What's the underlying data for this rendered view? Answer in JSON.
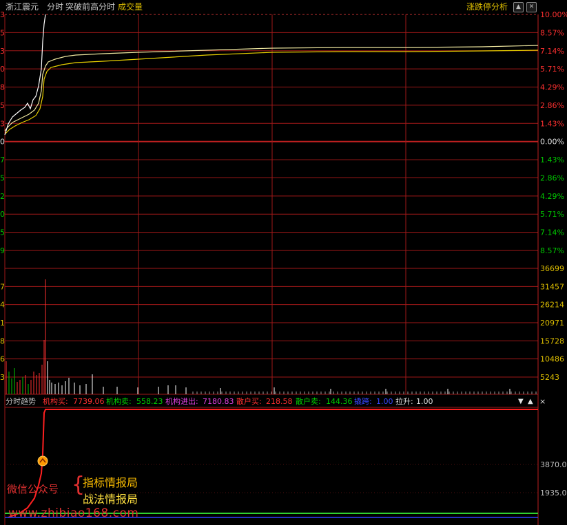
{
  "header": {
    "stock_name": "浙江震元",
    "mode_fenshi": "分时",
    "indicator_name": "突破前高分时",
    "volume_label": "成交量",
    "right_title": "涨跌停分析",
    "up_arrow": "▲",
    "close_icon": "✕"
  },
  "price_axis": {
    "right_labels": [
      "10.00%",
      "8.57%",
      "7.14%",
      "5.71%",
      "4.29%",
      "2.86%",
      "1.43%",
      "0.00%",
      "1.43%",
      "2.86%",
      "4.29%",
      "5.71%",
      "7.14%",
      "8.57%"
    ],
    "left_labels": [
      "3",
      "5",
      "3",
      "0",
      "8",
      "5",
      "3",
      "0",
      "7",
      "5",
      "2",
      "0",
      "5",
      "9"
    ]
  },
  "volume_axis": {
    "right_labels": [
      "36699",
      "31457",
      "26214",
      "20971",
      "15728",
      "10486",
      "5243"
    ],
    "left_labels": [
      "7",
      "4",
      "1",
      "8",
      "6",
      "3"
    ]
  },
  "indicator": {
    "name": "分时趋势",
    "jg_buy_label": "机构买:",
    "jg_buy_value": "7739.06",
    "jg_sell_label": "机构卖:",
    "jg_sell_value": "558.23",
    "jg_net_label": "机构进出:",
    "jg_net_value": "7180.83",
    "sh_buy_label": "散户买:",
    "sh_buy_value": "218.58",
    "sh_sell_label": "散户卖:",
    "sh_sell_value": "144.36",
    "ht_label": "撬跨:",
    "ht_value": "1.00",
    "ls_label": "拉升:",
    "ls_value": "1.00",
    "dropdown_icon": "▼",
    "up_icon": "▲",
    "close_icon": "×",
    "right_labels": [
      "3870.0",
      "1935.0"
    ]
  },
  "watermark": {
    "line1": "微信公众号",
    "brace": "{",
    "line2": "指标情报局",
    "line3": "战法情报局",
    "url": "www.zhibiao168.com"
  },
  "colors": {
    "grid_red": "#a01818",
    "up_red": "#ff3030",
    "down_green": "#00c800",
    "yellow": "#e0c000",
    "white": "#ffffff",
    "magenta": "#e040e0",
    "blue": "#3040ff",
    "indicator_green": "#30d030"
  }
}
